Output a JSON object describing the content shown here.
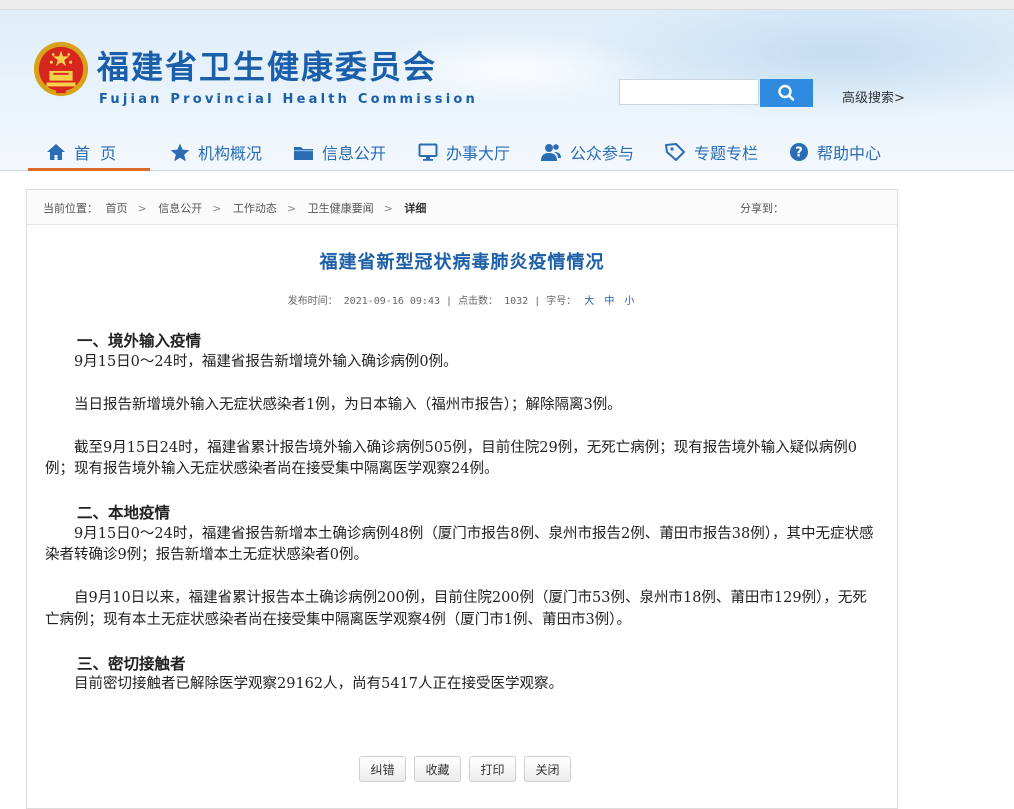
{
  "header": {
    "title": "福建省卫生健康委员会",
    "subtitle": "Fujian Provincial Health Commission",
    "search_placeholder": "",
    "advanced_search": "高级搜索>",
    "emblem_icon": "national-emblem-icon",
    "accent_color": "#1b5fab"
  },
  "nav": [
    {
      "label": "首  页",
      "icon": "home-icon"
    },
    {
      "label": "机构概况",
      "icon": "star-icon"
    },
    {
      "label": "信息公开",
      "icon": "folder-icon"
    },
    {
      "label": "办事大厅",
      "icon": "monitor-icon"
    },
    {
      "label": "公众参与",
      "icon": "people-icon"
    },
    {
      "label": "专题专栏",
      "icon": "tag-icon"
    },
    {
      "label": "帮助中心",
      "icon": "help-icon"
    }
  ],
  "breadcrumb": {
    "prefix": "当前位置：",
    "items": [
      "首页",
      "信息公开",
      "工作动态",
      "卫生健康要闻",
      "详细"
    ],
    "share": "分享到："
  },
  "article": {
    "title": "福建省新型冠状病毒肺炎疫情情况",
    "meta_date_label": "发布时间：",
    "meta_date": "2021-09-16 09:43",
    "meta_clicks_label": "点击数：",
    "meta_clicks": "1032",
    "meta_fontsize_label": "字号：",
    "font_sizes": [
      "大",
      "中",
      "小"
    ],
    "sections": [
      {
        "heading": "一、境外输入疫情",
        "paragraphs": [
          "9月15日0～24时，福建省报告新增境外输入确诊病例0例。",
          "当日报告新增境外输入无症状感染者1例，为日本输入（福州市报告）；解除隔离3例。",
          "截至9月15日24时，福建省累计报告境外输入确诊病例505例，目前住院29例，无死亡病例；现有报告境外输入疑似病例0例；现有报告境外输入无症状感染者尚在接受集中隔离医学观察24例。"
        ]
      },
      {
        "heading": "二、本地疫情",
        "paragraphs": [
          "9月15日0～24时，福建省报告新增本土确诊病例48例（厦门市报告8例、泉州市报告2例、莆田市报告38例），其中无症状感染者转确诊9例；报告新增本土无症状感染者0例。",
          "自9月10日以来，福建省累计报告本土确诊病例200例，目前住院200例（厦门市53例、泉州市18例、莆田市129例），无死亡病例；现有本土无症状感染者尚在接受集中隔离医学观察4例（厦门市1例、莆田市3例）。"
        ]
      },
      {
        "heading": "三、密切接触者",
        "paragraphs": [
          "目前密切接触者已解除医学观察29162人，尚有5417人正在接受医学观察。"
        ]
      }
    ]
  },
  "actions": [
    "纠错",
    "收藏",
    "打印",
    "关闭"
  ]
}
